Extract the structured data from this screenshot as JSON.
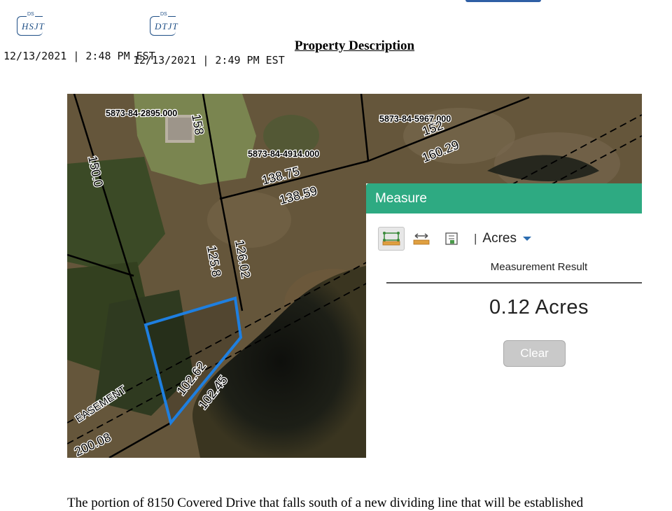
{
  "signatures": {
    "initial_1": {
      "badge": "DS",
      "ink": "HSJT"
    },
    "initial_2": {
      "badge": "DS",
      "ink": "DTJT"
    }
  },
  "timestamps": [
    "12/13/2021 | 2:48 PM EST",
    "12/13/2021 | 2:49 PM EST"
  ],
  "document": {
    "title": "Property Description",
    "body_text": "The portion of 8150 Covered Drive that falls south of a new dividing line that will be established"
  },
  "map": {
    "parcel_ids": [
      "5873-84-2895.000",
      "5873-84-4914.000",
      "5873-84-5967.000"
    ],
    "dimensions": [
      "158",
      "152",
      "150.0",
      "160.29",
      "138.75",
      "138.59",
      "125.8",
      "126.02",
      "102.62",
      "102.45",
      "200.08"
    ],
    "easement_label": "EASEMENT",
    "highlight_color": "#1e7fe0"
  },
  "measure_panel": {
    "header": "Measure",
    "tools": [
      "area-tool-icon",
      "distance-tool-icon",
      "location-tool-icon"
    ],
    "separator": "|",
    "unit": "Acres",
    "result_label": "Measurement Result",
    "result_value": "0.12 Acres",
    "clear_label": "Clear",
    "accent_color": "#2eaa82"
  }
}
